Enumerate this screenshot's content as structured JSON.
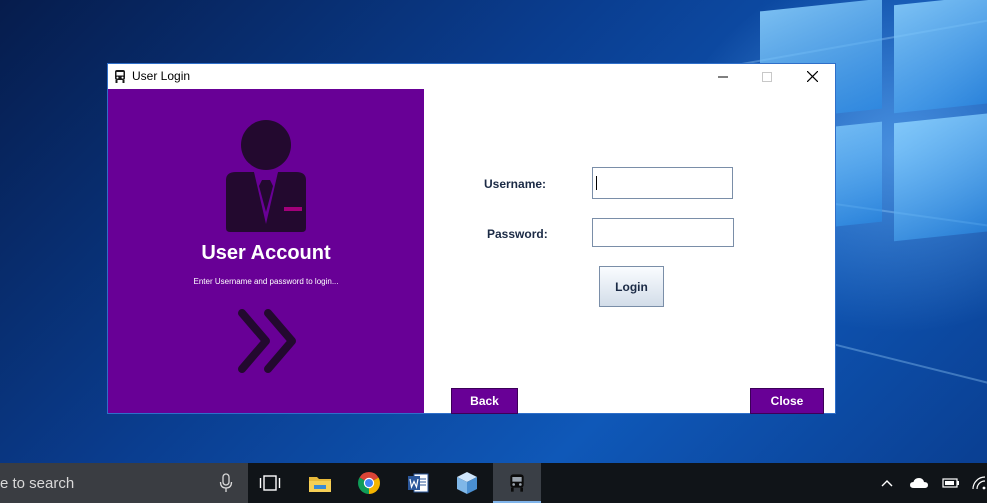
{
  "window": {
    "title": "User Login",
    "minimize_symbol": "—",
    "close_symbol": "✕"
  },
  "left_panel": {
    "heading": "User Account",
    "subtext": "Enter Username and password to login...",
    "background_color": "#680096",
    "icons": [
      "user-account-icon",
      "double-chevron-right-icon"
    ]
  },
  "form": {
    "username_label": "Username:",
    "username_value": "",
    "password_label": "Password:",
    "password_value": "",
    "login_label": "Login"
  },
  "buttons": {
    "back_label": "Back",
    "close_label": "Close"
  },
  "taskbar": {
    "search_text": "e to search",
    "apps": [
      "task-view-icon",
      "file-explorer-icon",
      "chrome-icon",
      "word-icon",
      "cube-app-icon",
      "bus-app-icon"
    ]
  }
}
